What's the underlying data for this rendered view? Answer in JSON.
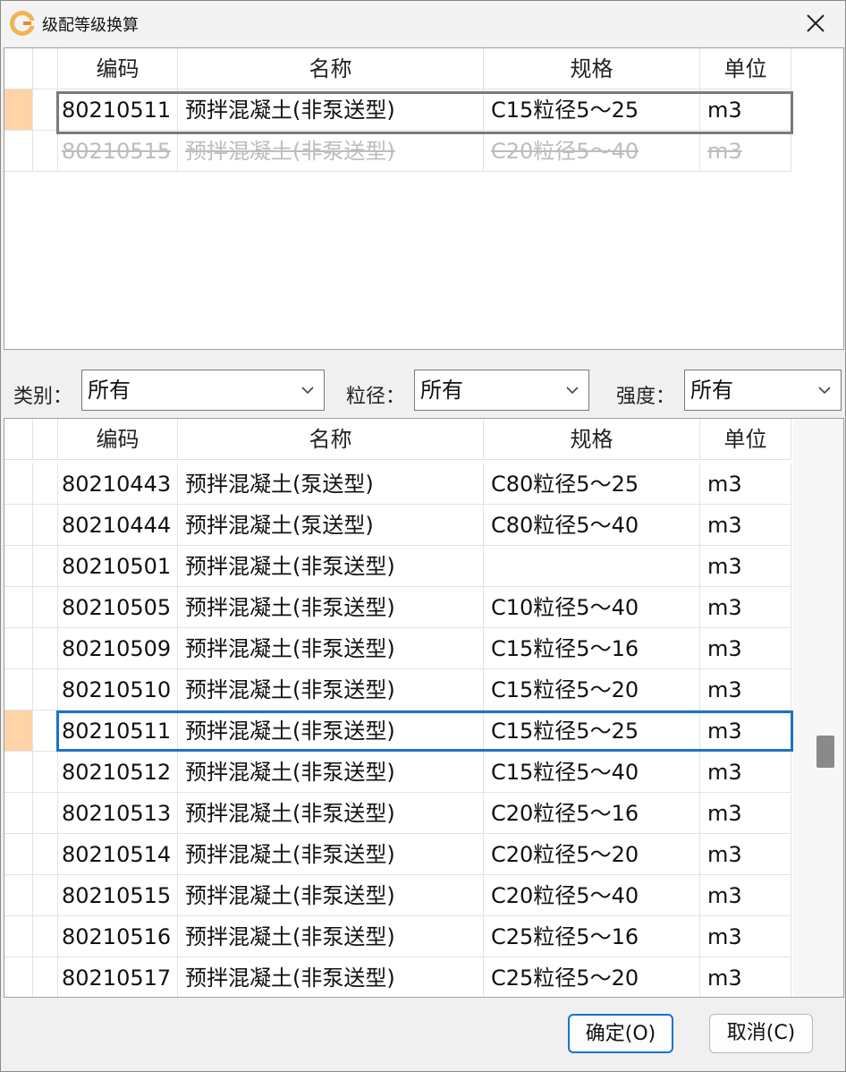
{
  "window": {
    "title": "级配等级换算"
  },
  "columns": {
    "code": "编码",
    "name": "名称",
    "spec": "规格",
    "unit": "单位"
  },
  "top_rows": [
    {
      "code": "80210511",
      "name": "预拌混凝土(非泵送型)",
      "spec": "C15粒径5～25",
      "unit": "m3"
    },
    {
      "code": "80210515",
      "name": "预拌混凝土(非泵送型)",
      "spec": "C20粒径5～40",
      "unit": "m3"
    }
  ],
  "filters": {
    "category": {
      "label": "类别：",
      "value": "所有"
    },
    "grain": {
      "label": "粒径：",
      "value": "所有"
    },
    "strength": {
      "label": "强度：",
      "value": "所有"
    }
  },
  "bottom_rows": [
    {
      "code": "80210443",
      "name": "预拌混凝土(泵送型)",
      "spec": "C80粒径5～25",
      "unit": "m3"
    },
    {
      "code": "80210444",
      "name": "预拌混凝土(泵送型)",
      "spec": "C80粒径5～40",
      "unit": "m3"
    },
    {
      "code": "80210501",
      "name": "预拌混凝土(非泵送型)",
      "spec": "",
      "unit": "m3"
    },
    {
      "code": "80210505",
      "name": "预拌混凝土(非泵送型)",
      "spec": "C10粒径5～40",
      "unit": "m3"
    },
    {
      "code": "80210509",
      "name": "预拌混凝土(非泵送型)",
      "spec": "C15粒径5～16",
      "unit": "m3"
    },
    {
      "code": "80210510",
      "name": "预拌混凝土(非泵送型)",
      "spec": "C15粒径5～20",
      "unit": "m3"
    },
    {
      "code": "80210511",
      "name": "预拌混凝土(非泵送型)",
      "spec": "C15粒径5～25",
      "unit": "m3"
    },
    {
      "code": "80210512",
      "name": "预拌混凝土(非泵送型)",
      "spec": "C15粒径5～40",
      "unit": "m3"
    },
    {
      "code": "80210513",
      "name": "预拌混凝土(非泵送型)",
      "spec": "C20粒径5～16",
      "unit": "m3"
    },
    {
      "code": "80210514",
      "name": "预拌混凝土(非泵送型)",
      "spec": "C20粒径5～20",
      "unit": "m3"
    },
    {
      "code": "80210515",
      "name": "预拌混凝土(非泵送型)",
      "spec": "C20粒径5～40",
      "unit": "m3"
    },
    {
      "code": "80210516",
      "name": "预拌混凝土(非泵送型)",
      "spec": "C25粒径5～16",
      "unit": "m3"
    },
    {
      "code": "80210517",
      "name": "预拌混凝土(非泵送型)",
      "spec": "C25粒径5～20",
      "unit": "m3"
    }
  ],
  "buttons": {
    "ok": "确定(O)",
    "cancel": "取消(C)"
  },
  "colors": {
    "selection_row": "#ffd3a8",
    "selection_border": "#1a73c8",
    "accent": "#1a73c8"
  },
  "icons": {
    "app": "app-logo-icon",
    "close": "close-icon",
    "dropdown": "chevron-down-icon"
  }
}
